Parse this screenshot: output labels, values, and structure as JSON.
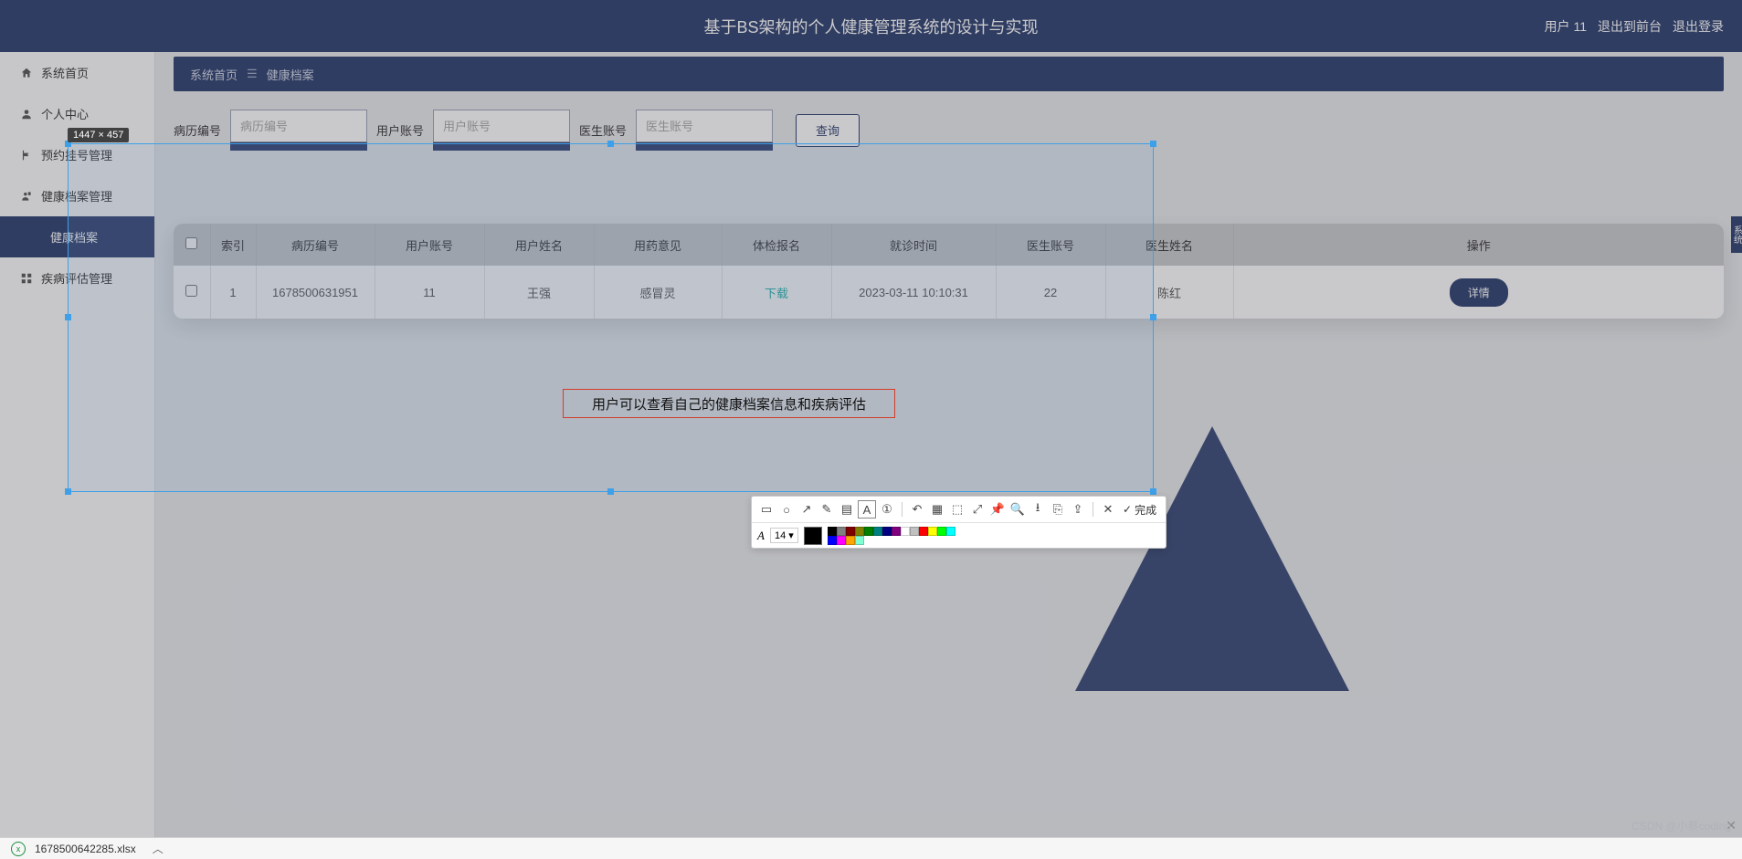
{
  "header": {
    "title": "基于BS架构的个人健康管理系统的设计与实现",
    "user_label": "用户 11",
    "to_front": "退出到前台",
    "logout": "退出登录"
  },
  "sidebar": {
    "items": [
      {
        "label": "系统首页",
        "icon": "home"
      },
      {
        "label": "个人中心",
        "icon": "person"
      },
      {
        "label": "预约挂号管理",
        "icon": "flag"
      },
      {
        "label": "健康档案管理",
        "icon": "person-file"
      },
      {
        "label": "健康档案",
        "icon": "",
        "active": true
      },
      {
        "label": "疾病评估管理",
        "icon": "grid"
      }
    ]
  },
  "breadcrumb": {
    "root": "系统首页",
    "current": "健康档案"
  },
  "search": {
    "fields": [
      {
        "label": "病历编号",
        "placeholder": "病历编号"
      },
      {
        "label": "用户账号",
        "placeholder": "用户账号"
      },
      {
        "label": "医生账号",
        "placeholder": "医生账号"
      }
    ],
    "query_btn": "查询"
  },
  "table": {
    "headers": [
      "索引",
      "病历编号",
      "用户账号",
      "用户姓名",
      "用药意见",
      "体检报名",
      "就诊时间",
      "医生账号",
      "医生姓名",
      "操作"
    ],
    "rows": [
      {
        "index": "1",
        "record_id": "1678500631951",
        "user_account": "11",
        "user_name": "王强",
        "med_opinion": "感冒灵",
        "exam_signup": "下载",
        "visit_time": "2023-03-11 10:10:31",
        "doctor_account": "22",
        "doctor_name": "陈红",
        "detail_btn": "详情"
      }
    ]
  },
  "annotation": {
    "text": "用户可以查看自己的健康档案信息和疾病评估"
  },
  "selection": {
    "dim_label": "1447 × 457"
  },
  "snip_toolbar": {
    "font_letter": "A",
    "font_size": "14",
    "done_label": "完成",
    "palette": [
      "#000000",
      "#808080",
      "#800000",
      "#808000",
      "#008000",
      "#008080",
      "#000080",
      "#800080",
      "#ffffff",
      "#c0c0c0",
      "#ff0000",
      "#ffff00",
      "#00ff00",
      "#00ffff",
      "#0000ff",
      "#ff00ff",
      "#ffa500",
      "#7fffd4"
    ]
  },
  "bottom_bar": {
    "filename": "1678500642285.xlsx"
  },
  "watermark": "CSDN @小蔡coding",
  "right_tab": "系统"
}
